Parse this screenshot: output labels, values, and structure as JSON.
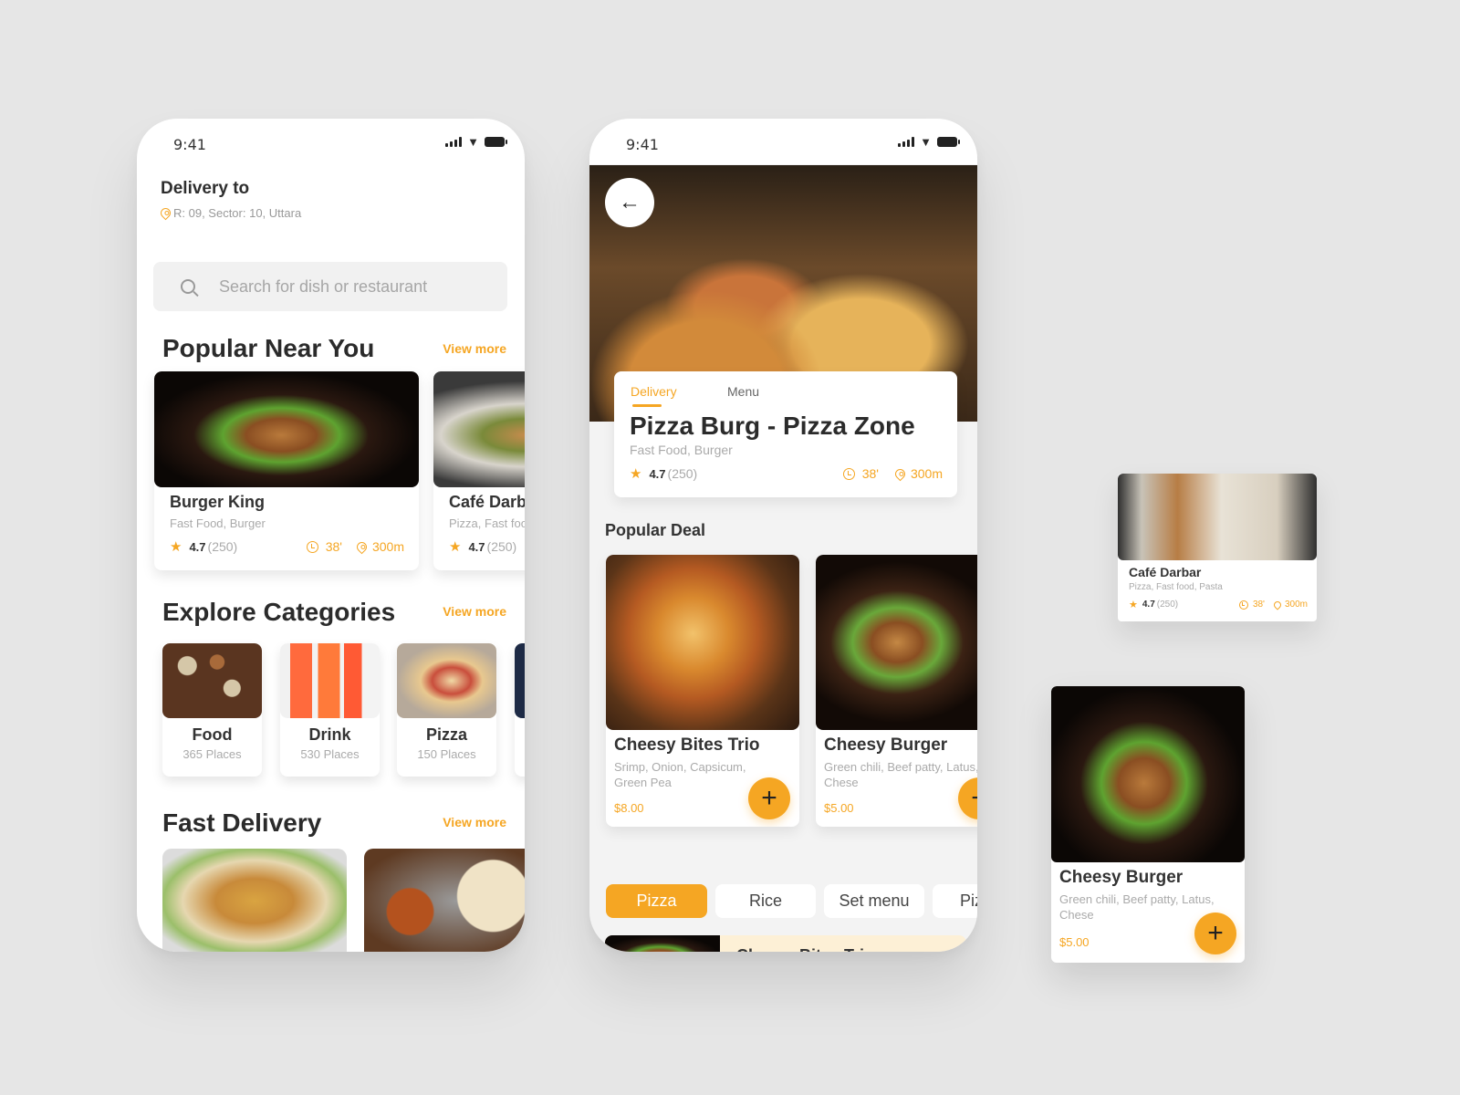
{
  "status_bar": {
    "time": "9:41"
  },
  "home": {
    "delivery_label": "Delivery to",
    "address": "R: 09, Sector: 10, Uttara",
    "search": {
      "placeholder": "Search for dish or restaurant",
      "value": ""
    },
    "popular": {
      "title": "Popular Near You",
      "view_more": "View more",
      "restaurants": [
        {
          "name": "Burger King",
          "categories": "Fast Food, Burger",
          "rating": "4.7",
          "reviews": "(250)",
          "time": "38'",
          "distance": "300m"
        },
        {
          "name": "Café Darbar",
          "categories": "Pizza, Fast food, Pasta",
          "rating": "4.7",
          "reviews": "(250)",
          "time": "38'",
          "distance": "300m"
        }
      ]
    },
    "categories": {
      "title": "Explore Categories",
      "view_more": "View more",
      "items": [
        {
          "label": "Food",
          "places": "365 Places"
        },
        {
          "label": "Drink",
          "places": "530 Places"
        },
        {
          "label": "Pizza",
          "places": "150 Places"
        }
      ]
    },
    "fast_delivery": {
      "title": "Fast Delivery",
      "view_more": "View more"
    }
  },
  "restaurant": {
    "tabs": [
      {
        "label": "Delivery",
        "active": true
      },
      {
        "label": "Menu",
        "active": false
      }
    ],
    "name": "Pizza Burg - Pizza Zone",
    "categories": "Fast Food, Burger",
    "rating": "4.7",
    "reviews": "(250)",
    "time": "38'",
    "distance": "300m",
    "popular_deal_title": "Popular Deal",
    "deals": [
      {
        "name": "Cheesy Bites Trio",
        "desc": "Srimp, Onion, Capsicum, Green Pea",
        "price": "$8.00"
      },
      {
        "name": "Cheesy Burger",
        "desc": "Green chili, Beef patty, Latus, Chese",
        "price": "$5.00"
      }
    ],
    "menu_chips": [
      {
        "label": "Pizza",
        "active": true
      },
      {
        "label": "Rice",
        "active": false
      },
      {
        "label": "Set menu",
        "active": false
      },
      {
        "label": "Pizza",
        "active": false
      }
    ],
    "list_item": {
      "name": "Cheesy Bites Trio"
    }
  },
  "floating": {
    "cafe_card": {
      "name": "Café Darbar",
      "categories": "Pizza, Fast food, Pasta",
      "rating": "4.7",
      "reviews": "(250)",
      "time": "38'",
      "distance": "300m"
    },
    "burger_card": {
      "name": "Cheesy Burger",
      "desc": "Green chili, Beef patty, Latus, Chese",
      "price": "$5.00"
    }
  },
  "icons": {
    "add": "+",
    "back": "←",
    "star": "★"
  },
  "colors": {
    "accent": "#f5a623",
    "background": "#e6e6e6",
    "text": "#2b2b2b",
    "muted": "#aaaaaa"
  }
}
